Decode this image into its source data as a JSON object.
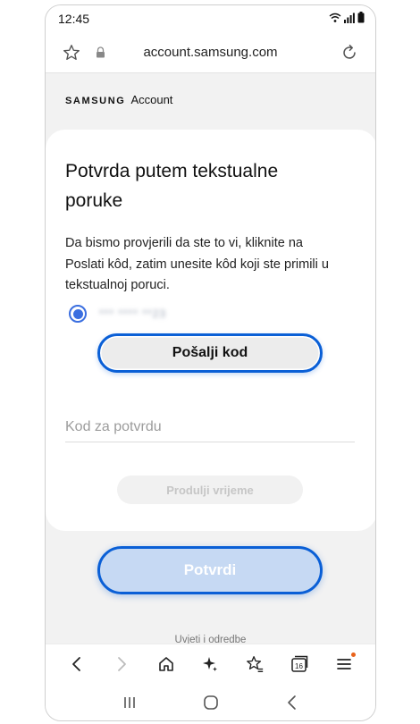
{
  "status_bar": {
    "time": "12:45"
  },
  "browser": {
    "url": "account.samsung.com"
  },
  "brand": {
    "samsung": "SAMSUNG",
    "account": "Account"
  },
  "page": {
    "title": "Potvrda putem tekstualne poruke",
    "description": "Da bismo provjerili da ste to vi, kliknite na Poslati kôd, zatim unesite kôd koji ste primili u tekstualnoj poruci.",
    "phone_masked": "*** **** **23",
    "send_code_label": "Pošalji kod",
    "code_placeholder": "Kod za potvrdu",
    "extend_time_label": "Produlji vrijeme",
    "confirm_label": "Potvrdi",
    "terms_label": "Uvjeti i odredbe"
  },
  "browser_nav": {
    "tabs_count": "16"
  },
  "colors": {
    "accent": "#0a5fd6",
    "radio": "#3b6fe0",
    "confirm_bg": "#c6d9f3",
    "card_bg": "#ffffff",
    "page_bg": "#f2f2f2"
  }
}
